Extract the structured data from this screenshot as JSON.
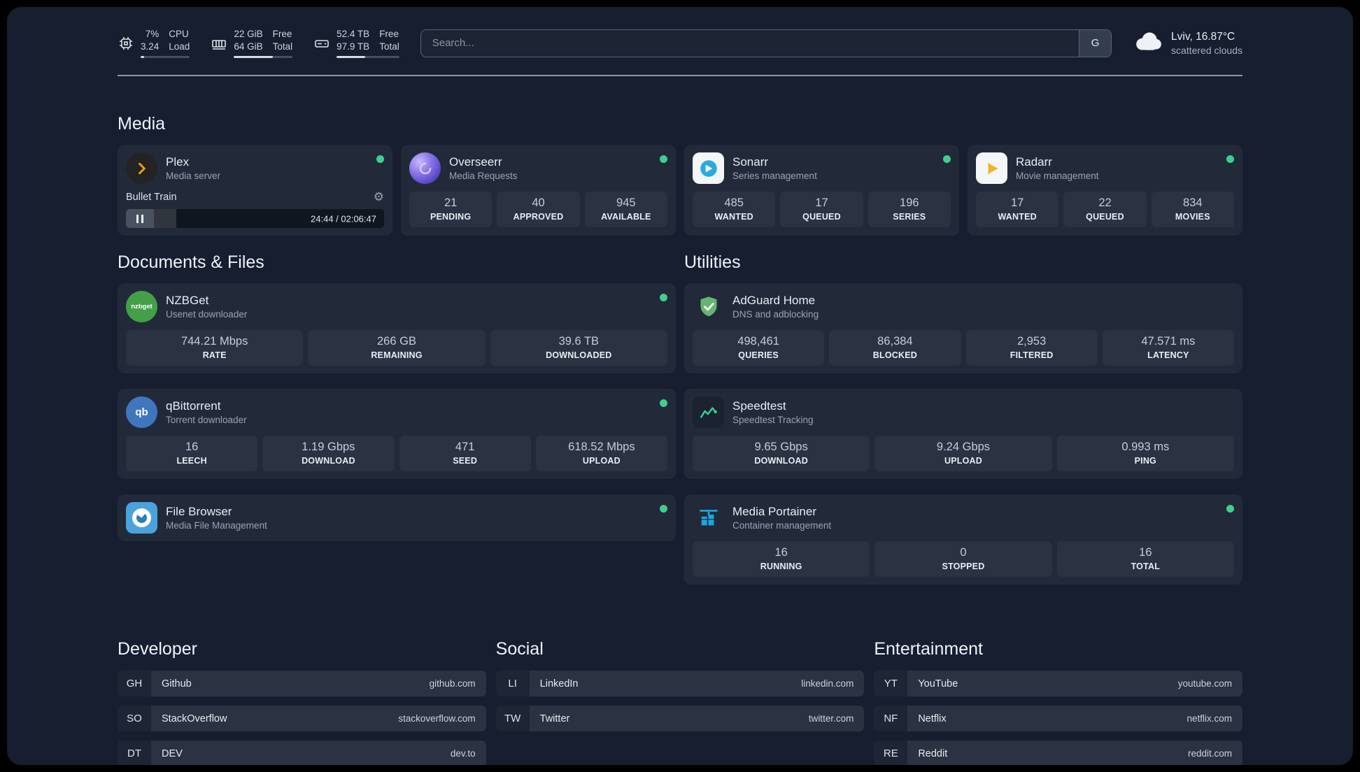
{
  "header": {
    "cpu": {
      "percent": "7%",
      "load": "3.24",
      "label_top": "CPU",
      "label_bottom": "Load",
      "progress": 7
    },
    "memory": {
      "free": "22 GiB",
      "total": "64 GiB",
      "label_top": "Free",
      "label_bottom": "Total",
      "progress": 66
    },
    "disk": {
      "free": "52.4 TB",
      "total": "97.9 TB",
      "label_top": "Free",
      "label_bottom": "Total",
      "progress": 46
    },
    "search": {
      "placeholder": "Search...",
      "button": "G"
    },
    "weather": {
      "location": "Lviv, 16.87°C",
      "condition": "scattered clouds"
    }
  },
  "media": {
    "title": "Media",
    "plex": {
      "title": "Plex",
      "subtitle": "Media server",
      "track": "Bullet Train",
      "time": "24:44 / 02:06:47",
      "progress": 19.5
    },
    "overseerr": {
      "title": "Overseerr",
      "subtitle": "Media Requests",
      "stats": [
        {
          "value": "21",
          "label": "PENDING"
        },
        {
          "value": "40",
          "label": "APPROVED"
        },
        {
          "value": "945",
          "label": "AVAILABLE"
        }
      ]
    },
    "sonarr": {
      "title": "Sonarr",
      "subtitle": "Series management",
      "stats": [
        {
          "value": "485",
          "label": "WANTED"
        },
        {
          "value": "17",
          "label": "QUEUED"
        },
        {
          "value": "196",
          "label": "SERIES"
        }
      ]
    },
    "radarr": {
      "title": "Radarr",
      "subtitle": "Movie management",
      "stats": [
        {
          "value": "17",
          "label": "WANTED"
        },
        {
          "value": "22",
          "label": "QUEUED"
        },
        {
          "value": "834",
          "label": "MOVIES"
        }
      ]
    }
  },
  "documents": {
    "title": "Documents & Files",
    "nzbget": {
      "title": "NZBGet",
      "subtitle": "Usenet downloader",
      "icon_text": "nzbget",
      "stats": [
        {
          "value": "744.21 Mbps",
          "label": "RATE"
        },
        {
          "value": "266 GB",
          "label": "REMAINING"
        },
        {
          "value": "39.6 TB",
          "label": "DOWNLOADED"
        }
      ]
    },
    "qbittorrent": {
      "title": "qBittorrent",
      "subtitle": "Torrent downloader",
      "icon_text": "qb",
      "stats": [
        {
          "value": "16",
          "label": "LEECH"
        },
        {
          "value": "1.19 Gbps",
          "label": "DOWNLOAD"
        },
        {
          "value": "471",
          "label": "SEED"
        },
        {
          "value": "618.52 Mbps",
          "label": "UPLOAD"
        }
      ]
    },
    "filebrowser": {
      "title": "File Browser",
      "subtitle": "Media File Management"
    }
  },
  "utilities": {
    "title": "Utilities",
    "adguard": {
      "title": "AdGuard Home",
      "subtitle": "DNS and adblocking",
      "stats": [
        {
          "value": "498,461",
          "label": "QUERIES"
        },
        {
          "value": "86,384",
          "label": "BLOCKED"
        },
        {
          "value": "2,953",
          "label": "FILTERED"
        },
        {
          "value": "47.571 ms",
          "label": "LATENCY"
        }
      ]
    },
    "speedtest": {
      "title": "Speedtest",
      "subtitle": "Speedtest Tracking",
      "stats": [
        {
          "value": "9.65 Gbps",
          "label": "DOWNLOAD"
        },
        {
          "value": "9.24 Gbps",
          "label": "UPLOAD"
        },
        {
          "value": "0.993 ms",
          "label": "PING"
        }
      ]
    },
    "portainer": {
      "title": "Media Portainer",
      "subtitle": "Container management",
      "stats": [
        {
          "value": "16",
          "label": "RUNNING"
        },
        {
          "value": "0",
          "label": "STOPPED"
        },
        {
          "value": "16",
          "label": "TOTAL"
        }
      ]
    }
  },
  "bookmarks": {
    "developer": {
      "title": "Developer",
      "items": [
        {
          "abbr": "GH",
          "name": "Github",
          "url": "github.com"
        },
        {
          "abbr": "SO",
          "name": "StackOverflow",
          "url": "stackoverflow.com"
        },
        {
          "abbr": "DT",
          "name": "DEV",
          "url": "dev.to"
        }
      ]
    },
    "social": {
      "title": "Social",
      "items": [
        {
          "abbr": "LI",
          "name": "LinkedIn",
          "url": "linkedin.com"
        },
        {
          "abbr": "TW",
          "name": "Twitter",
          "url": "twitter.com"
        }
      ]
    },
    "entertainment": {
      "title": "Entertainment",
      "items": [
        {
          "abbr": "YT",
          "name": "YouTube",
          "url": "youtube.com"
        },
        {
          "abbr": "NF",
          "name": "Netflix",
          "url": "netflix.com"
        },
        {
          "abbr": "RE",
          "name": "Reddit",
          "url": "reddit.com"
        }
      ]
    }
  }
}
